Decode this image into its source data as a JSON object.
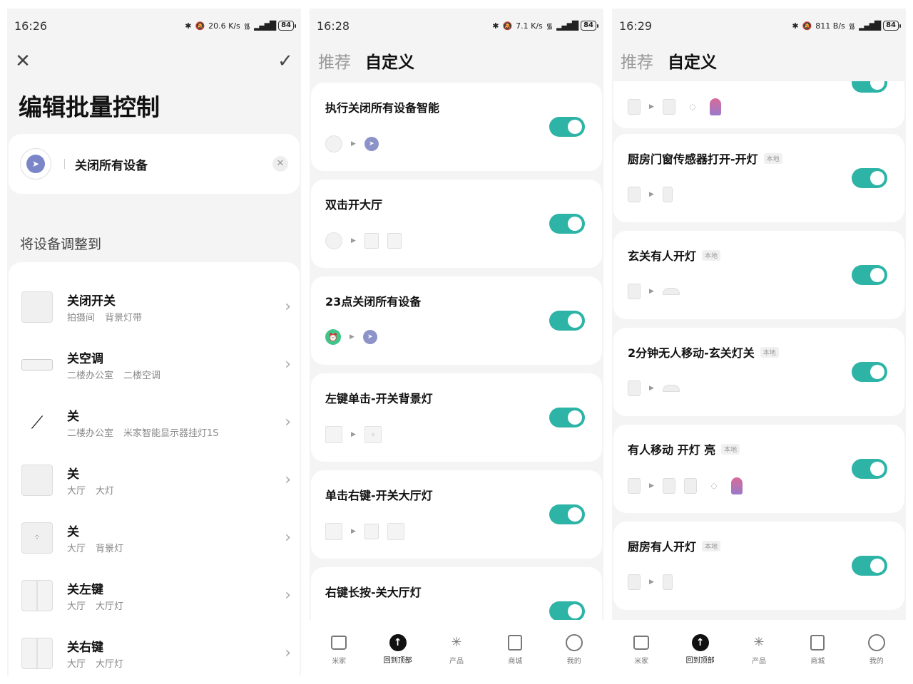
{
  "phone1": {
    "status": {
      "time": "16:26",
      "net_speed": "20.6 K/s",
      "battery": "84"
    },
    "close_icon": "close-icon",
    "confirm_icon": "check-icon",
    "title": "编辑批量控制",
    "scene": {
      "name": "关闭所有设备"
    },
    "section_label": "将设备调整到",
    "devices": [
      {
        "title": "关闭开关",
        "room": "拍摄间",
        "name": "背景灯带"
      },
      {
        "title": "关空调",
        "room": "二楼办公室",
        "name": "二楼空调"
      },
      {
        "title": "关",
        "room": "二楼办公室",
        "name": "米家智能显示器挂灯1S"
      },
      {
        "title": "关",
        "room": "大厅",
        "name": "大灯"
      },
      {
        "title": "关",
        "room": "大厅",
        "name": "背景灯"
      },
      {
        "title": "关左键",
        "room": "大厅",
        "name": "大厅灯"
      },
      {
        "title": "关右键",
        "room": "大厅",
        "name": "大厅灯"
      }
    ]
  },
  "phone2": {
    "status": {
      "time": "16:28",
      "net_speed": "7.1 K/s",
      "battery": "84"
    },
    "tabs": [
      {
        "label": "推荐"
      },
      {
        "label": "自定义"
      }
    ],
    "automations": [
      {
        "title": "执行关闭所有设备智能",
        "enabled": true
      },
      {
        "title": "双击开大厅",
        "enabled": true
      },
      {
        "title": "23点关闭所有设备",
        "enabled": true
      },
      {
        "title": "左键单击-开关背景灯",
        "enabled": true
      },
      {
        "title": "单击右键-开关大厅灯",
        "enabled": true
      },
      {
        "title": "右键长按-关大厅灯",
        "enabled": true
      }
    ]
  },
  "phone3": {
    "status": {
      "time": "16:29",
      "net_speed": "811 B/s",
      "battery": "84"
    },
    "tabs": [
      {
        "label": "推荐"
      },
      {
        "label": "自定义"
      }
    ],
    "local_badge": "本地",
    "automations": [
      {
        "title": "",
        "enabled": true
      },
      {
        "title": "厨房门窗传感器打开-开灯",
        "enabled": true,
        "local": true
      },
      {
        "title": "玄关有人开灯",
        "enabled": true,
        "local": true
      },
      {
        "title": "2分钟无人移动-玄关灯关",
        "enabled": true,
        "local": true
      },
      {
        "title": "有人移动 开灯 亮",
        "enabled": true,
        "local": true
      },
      {
        "title": "厨房有人开灯",
        "enabled": true,
        "local": true
      }
    ]
  },
  "bottom_nav": [
    {
      "label": "米家",
      "icon": "home-icon"
    },
    {
      "label": "回到顶部",
      "icon": "arrow-up-icon"
    },
    {
      "label": "产品",
      "icon": "sparkle-icon"
    },
    {
      "label": "商城",
      "icon": "store-icon"
    },
    {
      "label": "我的",
      "icon": "profile-icon"
    }
  ]
}
